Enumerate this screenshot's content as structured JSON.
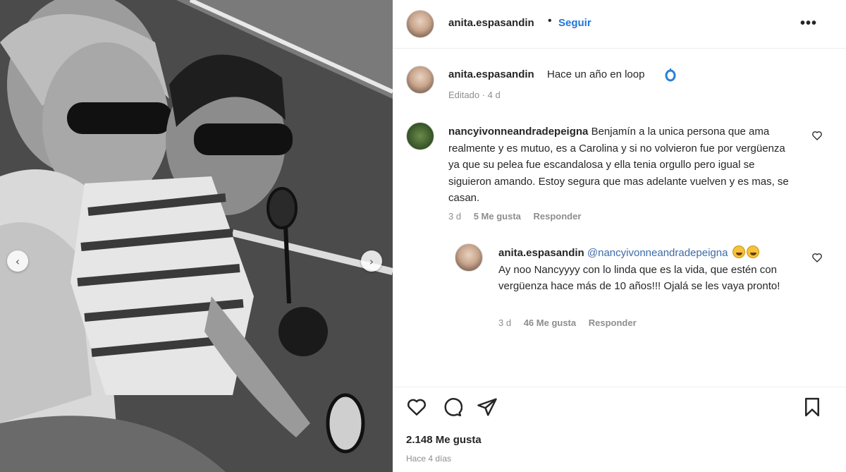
{
  "post": {
    "username": "anita.espasandin",
    "follow_label": "Seguir",
    "more_label": "•••",
    "separator": "•",
    "image_nav": {
      "prev": "‹",
      "next": "›"
    }
  },
  "caption": {
    "username": "anita.espasandin",
    "text": "Hace un año en loop",
    "meta": "Editado · 4 d"
  },
  "comments": [
    {
      "username": "nancyivonneandradepeigna",
      "text": "Benjamín a la unica persona que ama realmente y es mutuo, es a Carolina y si no volvieron fue por vergüenza ya que su pelea fue escandalosa y ella tenia orgullo pero igual se siguieron amando. Estoy segura que mas adelante vuelven y es mas, se casan.",
      "time": "3 d",
      "likes": "5 Me gusta",
      "reply_label": "Responder"
    },
    {
      "username": "anita.espasandin",
      "mention": "@nancyivonneandradepeigna",
      "text": "Ay noo Nancyyyy con lo linda que es la vida, que estén con vergüenza hace más de 10 años!!! Ojalá se les vaya pronto!",
      "time": "3 d",
      "likes": "46 Me gusta",
      "reply_label": "Responder"
    }
  ],
  "footer": {
    "likes": "2.148 Me gusta",
    "time": "Hace 4 días"
  },
  "icons": {
    "like": "heart-icon",
    "comment": "comment-icon",
    "share": "share-icon",
    "save": "bookmark-icon"
  },
  "colors": {
    "link": "#1f77d9",
    "mention": "#3d6aa8",
    "muted": "#8e8e8e",
    "text": "#262626"
  }
}
